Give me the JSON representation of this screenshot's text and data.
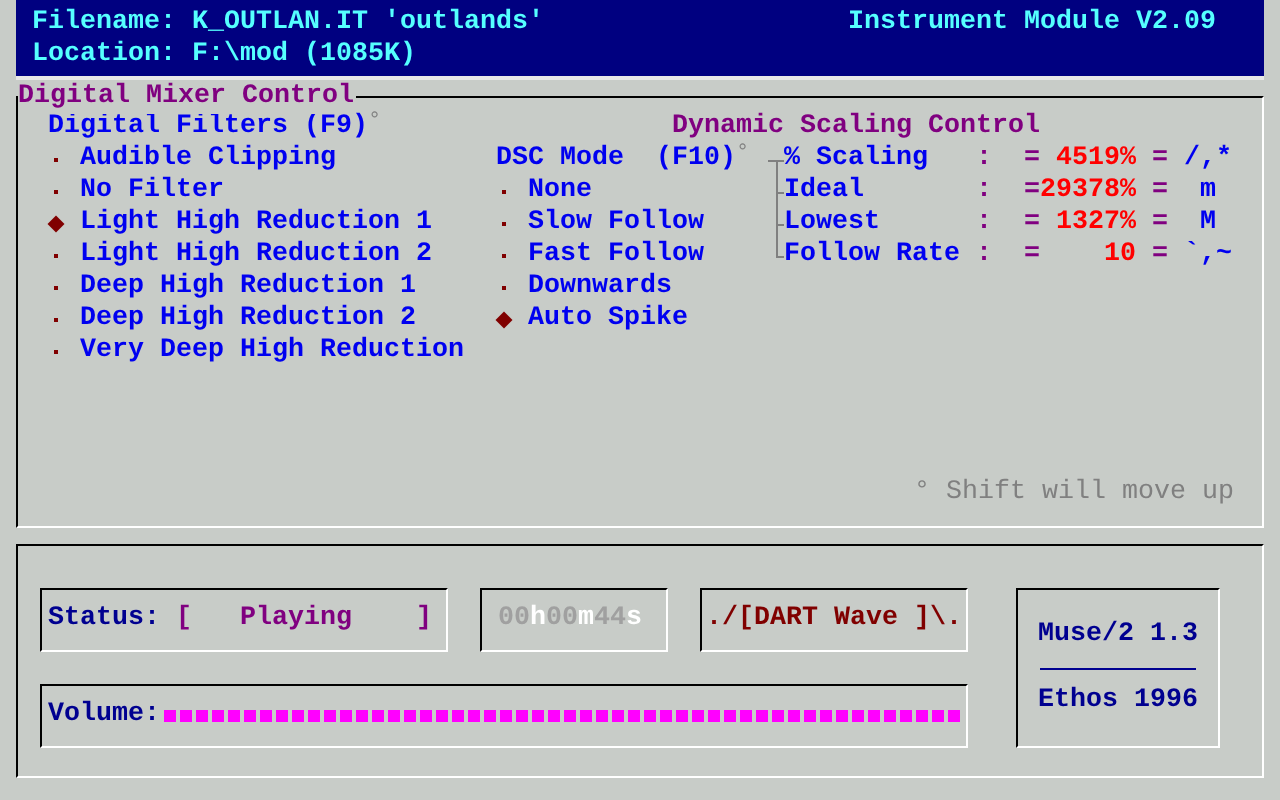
{
  "header": {
    "filename": "Filename: K_OUTLAN.IT 'outlands'",
    "module": "Instrument Module V2.09",
    "location": "Location: F:\\mod (1085K)"
  },
  "mixer": {
    "title": "Digital Mixer Control",
    "filters": {
      "heading": "Digital Filters (F9)",
      "hint_mark": "°",
      "items": [
        {
          "label": "Audible Clipping",
          "selected": false
        },
        {
          "label": "No Filter",
          "selected": false
        },
        {
          "label": "Light High Reduction 1",
          "selected": true
        },
        {
          "label": "Light High Reduction 2",
          "selected": false
        },
        {
          "label": "Deep High Reduction 1",
          "selected": false
        },
        {
          "label": "Deep High Reduction 2",
          "selected": false
        },
        {
          "label": "Very Deep High Reduction",
          "selected": false
        }
      ]
    },
    "dsc": {
      "title": "Dynamic Scaling Control",
      "heading": "DSC Mode  (F10)",
      "hint_mark": "°",
      "items": [
        {
          "label": "None",
          "selected": false
        },
        {
          "label": "Slow Follow",
          "selected": false
        },
        {
          "label": "Fast Follow",
          "selected": false
        },
        {
          "label": "Downwards",
          "selected": false
        },
        {
          "label": "Auto Spike",
          "selected": true
        }
      ],
      "readings": [
        {
          "label": "% Scaling",
          "colon": ":",
          "equals": "=",
          "value": "4519%",
          "equals_2": "=",
          "keys": "/,*"
        },
        {
          "label": "Ideal",
          "colon": ":",
          "equals": "=",
          "value": "29378%",
          "equals_2": "=",
          "keys": "m"
        },
        {
          "label": "Lowest",
          "colon": ":",
          "equals": "=",
          "value": "1327%",
          "equals_2": "=",
          "keys": "M"
        },
        {
          "label": "Follow Rate",
          "colon": ":",
          "equals": "=",
          "value": "10",
          "equals_2": "=",
          "keys": "`,~"
        }
      ]
    },
    "note": "° Shift will move up"
  },
  "player": {
    "status_label": "Status:",
    "status_value": "[   Playing    ]",
    "time": [
      {
        "text": "00",
        "kind": "number"
      },
      {
        "text": "h",
        "kind": "unit"
      },
      {
        "text": "00",
        "kind": "number"
      },
      {
        "text": "m",
        "kind": "unit"
      },
      {
        "text": "44",
        "kind": "number"
      },
      {
        "text": "s",
        "kind": "unit"
      }
    ],
    "device": "./[DART Wave ]\\.",
    "volume": {
      "label": "Volume:",
      "level": 1
    },
    "about": {
      "product": "Muse/2 1.3",
      "author": "Ethos 1996"
    }
  }
}
